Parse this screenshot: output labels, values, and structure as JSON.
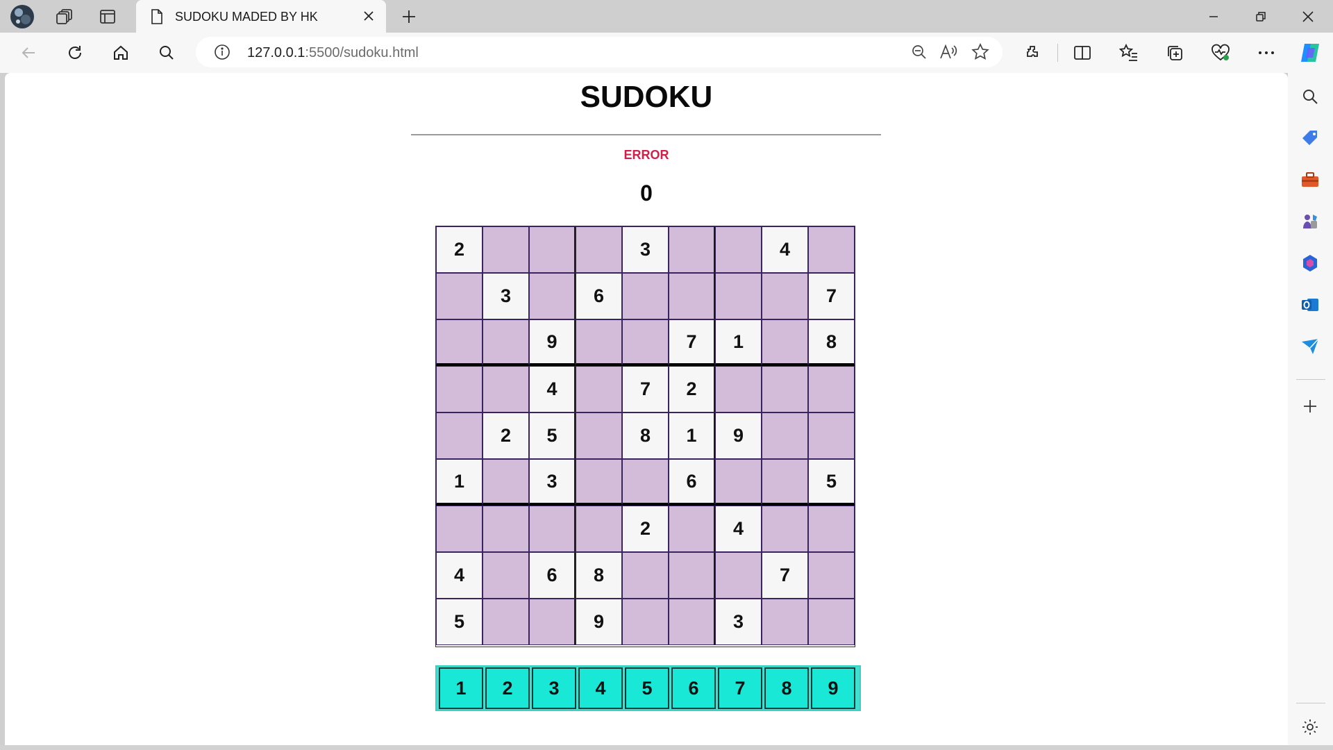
{
  "browser": {
    "tab_title": "SUDOKU MADED BY HK",
    "url_host": "127.0.0.1",
    "url_rest": ":5500/sudoku.html"
  },
  "page": {
    "title": "SUDOKU",
    "error_label": "ERROR",
    "error_count": "0"
  },
  "board": {
    "rows": [
      [
        "2",
        "",
        "",
        "",
        "3",
        "",
        "",
        "4",
        ""
      ],
      [
        "",
        "3",
        "",
        "6",
        "",
        "",
        "",
        "",
        "7"
      ],
      [
        "",
        "",
        "9",
        "",
        "",
        "7",
        "1",
        "",
        "8"
      ],
      [
        "",
        "",
        "4",
        "",
        "7",
        "2",
        "",
        "",
        ""
      ],
      [
        "",
        "2",
        "5",
        "",
        "8",
        "1",
        "9",
        "",
        ""
      ],
      [
        "1",
        "",
        "3",
        "",
        "",
        "6",
        "",
        "",
        "5"
      ],
      [
        "",
        "",
        "",
        "",
        "2",
        "",
        "4",
        "",
        ""
      ],
      [
        "4",
        "",
        "6",
        "8",
        "",
        "",
        "",
        "7",
        ""
      ],
      [
        "5",
        "",
        "",
        "9",
        "",
        "",
        "3",
        "",
        ""
      ]
    ]
  },
  "digits": [
    "1",
    "2",
    "3",
    "4",
    "5",
    "6",
    "7",
    "8",
    "9"
  ],
  "colors": {
    "empty_cell": "#d3bcda",
    "given_cell": "#f6f6f6",
    "digit_tile": "#18e8d5",
    "error_text": "#d21f4a"
  },
  "icons": {
    "tabstrip": [
      "profile-avatar-icon",
      "workspaces-icon",
      "vertical-tabs-icon",
      "page-icon",
      "close-icon",
      "plus-icon"
    ],
    "toolbar": [
      "back-icon",
      "refresh-icon",
      "home-icon",
      "search-icon",
      "info-icon",
      "zoom-out-icon",
      "read-aloud-icon",
      "favorite-star-icon",
      "extensions-icon",
      "split-screen-icon",
      "favorites-icon",
      "collections-icon",
      "browser-essentials-icon",
      "more-icon",
      "copilot-icon"
    ],
    "sidebar": [
      "search-icon",
      "shopping-tag-icon",
      "tools-icon",
      "games-icon",
      "microsoft365-icon",
      "outlook-icon",
      "send-icon",
      "add-icon",
      "settings-icon"
    ]
  }
}
